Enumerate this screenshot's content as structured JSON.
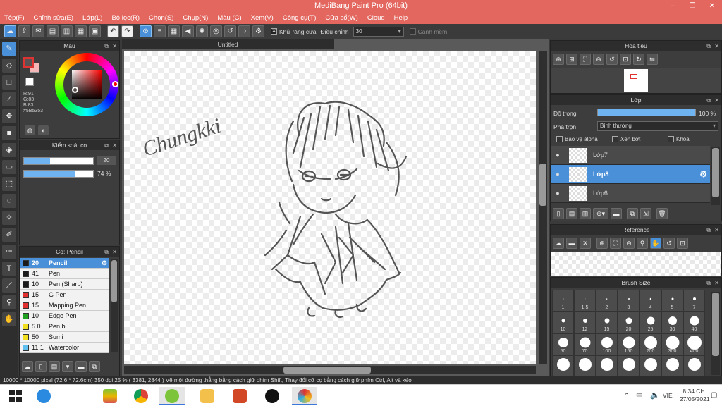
{
  "window": {
    "title": "MediBang Paint Pro (64bit)",
    "minimize": "–",
    "restore": "❐",
    "close": "✕"
  },
  "menu": [
    "Tệp(F)",
    "Chỉnh sửa(E)",
    "Lớp(L)",
    "Bộ lọc(R)",
    "Chọn(S)",
    "Chụp(N)",
    "Màu (C)",
    "Xem(V)",
    "Công cụ(T)",
    "Cửa sổ(W)",
    "Cloud",
    "Help"
  ],
  "toolbar": {
    "antialias_label": "Khử răng cưa",
    "antialias_check": "✕",
    "adjust_label": "Điều chỉnh",
    "adjust_value": "30",
    "edge_label": "Canh mềm"
  },
  "color_panel": {
    "title": "Màu",
    "r": "R:91",
    "g": "G:83",
    "b": "B:83",
    "hex": "#5B5353",
    "primary": "#5b5353",
    "secondary": "#f4b6b6"
  },
  "brush_control": {
    "title": "Kiểm soát cọ",
    "size": "20",
    "opacity": "74 %",
    "size_fill": 0.38,
    "opacity_fill": 0.74
  },
  "brush_panel": {
    "title": "Cọ: Pencil",
    "brushes": [
      {
        "size": "20",
        "name": "Pencil",
        "color": "#1a1a1a",
        "selected": true
      },
      {
        "size": "41",
        "name": "Pen",
        "color": "#1a1a1a"
      },
      {
        "size": "10",
        "name": "Pen (Sharp)",
        "color": "#1a1a1a"
      },
      {
        "size": "15",
        "name": "G Pen",
        "color": "#e03030"
      },
      {
        "size": "15",
        "name": "Mapping Pen",
        "color": "#e03030"
      },
      {
        "size": "10",
        "name": "Edge Pen",
        "color": "#20a020"
      },
      {
        "size": "5.0",
        "name": "Pen b",
        "color": "#f0e020"
      },
      {
        "size": "50",
        "name": "Sumi",
        "color": "#f0e020"
      },
      {
        "size": "11.1",
        "name": "Watercolor",
        "color": "#60c0f0"
      }
    ]
  },
  "canvas": {
    "tab": "Untitled",
    "signature": "Chungkki"
  },
  "navigator": {
    "title": "Hoa tiêu"
  },
  "layers": {
    "title": "Lớp",
    "opacity_label": "Độ trong",
    "opacity_value": "100 %",
    "opacity_fill": 1.0,
    "blend_label": "Pha trộn",
    "blend_value": "Bình thường",
    "alpha_label": "Bảo vệ alpha",
    "clip_label": "Xén bớt",
    "lock_label": "Khóa",
    "items": [
      {
        "name": "Lớp7",
        "selected": false
      },
      {
        "name": "Lớp8",
        "selected": true
      },
      {
        "name": "Lớp6",
        "selected": false
      }
    ]
  },
  "reference": {
    "title": "Reference"
  },
  "brush_size": {
    "title": "Brush Size",
    "sizes": [
      "1",
      "1.5",
      "2",
      "3",
      "4",
      "5",
      "7",
      "10",
      "12",
      "15",
      "20",
      "25",
      "30",
      "40",
      "50",
      "70",
      "100",
      "150",
      "200",
      "300",
      "400",
      "",
      "",
      "",
      "",
      "",
      "",
      ""
    ]
  },
  "status": {
    "text": "10000 * 10000 pixel   (72.6 * 72.6cm)   350 dpi   25 %   ( 3381, 2844 )   Vẽ một đường thẳng bằng cách giữ phím Shift, Thay đổi cỡ cọ bằng cách giữ phím Ctrl, Alt và kéo"
  },
  "taskbar": {
    "lang": "VIE",
    "time": "8:34 CH",
    "date": "27/05/2021",
    "apps": [
      "File Explorer",
      "Internet Explorer",
      "BlueStacks",
      "Chrome",
      "Vivo",
      "Files",
      "PowerPoint",
      "TikTok",
      "MediBang"
    ]
  }
}
